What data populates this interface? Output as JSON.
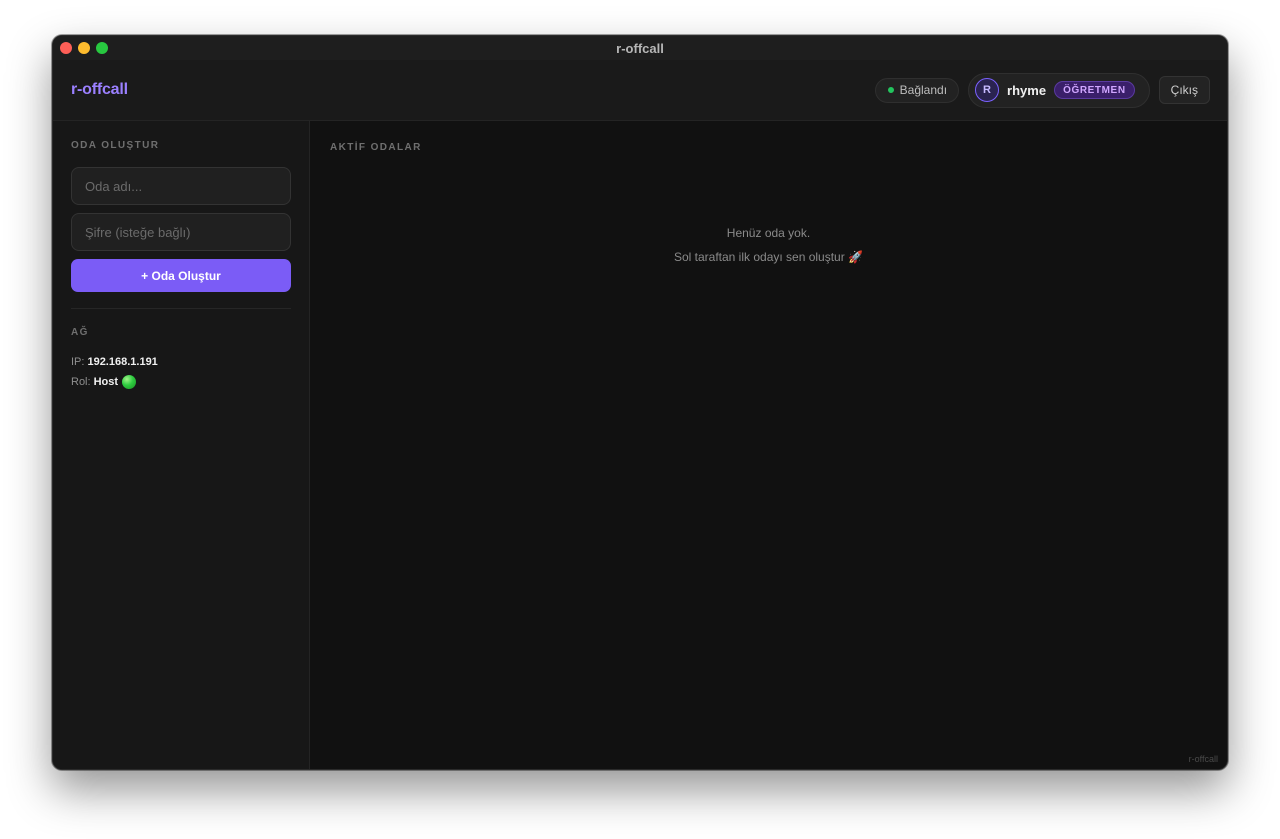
{
  "window": {
    "title": "r-offcall"
  },
  "header": {
    "brand": "r-offcall",
    "status_label": "Bağlandı",
    "user": {
      "initial": "R",
      "name": "rhyme",
      "role_badge": "ÖĞRETMEN"
    },
    "logout_label": "Çıkış"
  },
  "sidebar": {
    "create_section_label": "ODA OLUŞTUR",
    "room_name_placeholder": "Oda adı...",
    "password_placeholder": "Şifre (isteğe bağlı)",
    "create_button_label": "+ Oda Oluştur",
    "network_section_label": "AĞ",
    "ip_label": "IP:",
    "ip_value": "192.168.1.191",
    "role_label": "Rol:",
    "role_value": "Host"
  },
  "main": {
    "section_label": "AKTİF ODALAR",
    "empty_title": "Henüz oda yok.",
    "empty_subtitle": "Sol taraftan ilk odayı sen oluştur 🚀"
  },
  "footer": {
    "watermark": "r-offcall"
  },
  "colors": {
    "accent": "#7b5cf6",
    "brand": "#9b80ff",
    "status_ok": "#22c55e",
    "background": "#111111",
    "sidebar": "#171717"
  }
}
